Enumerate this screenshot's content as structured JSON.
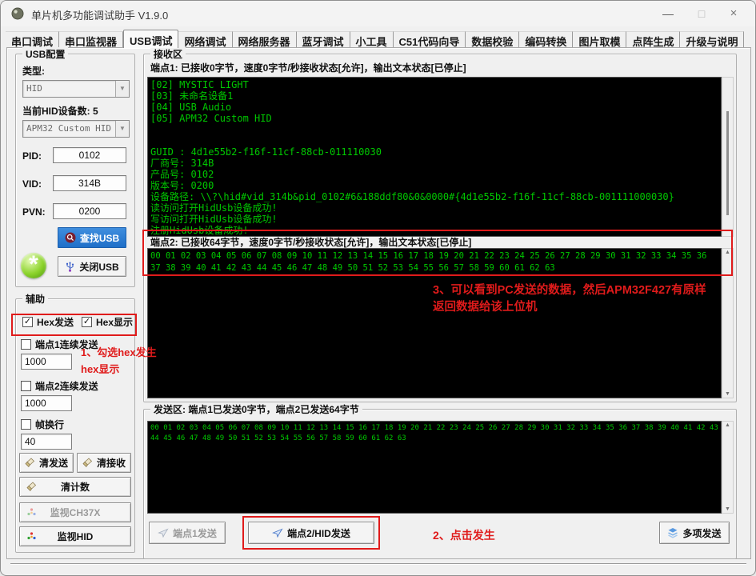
{
  "window": {
    "title": "单片机多功能调试助手 V1.9.0",
    "controls": {
      "minimize": "—",
      "maximize": "□",
      "close": "×"
    }
  },
  "tabs": {
    "active": "USB调试",
    "items": [
      "串口调试",
      "串口监视器",
      "USB调试",
      "网络调试",
      "网络服务器",
      "蓝牙调试",
      "小工具",
      "C51代码向导",
      "数据校验",
      "编码转换",
      "图片取模",
      "点阵生成",
      "升级与说明"
    ]
  },
  "usb_config": {
    "title": "USB配置",
    "type_label": "类型:",
    "type_value": "HID",
    "device_count_label": "当前HID设备数: 5",
    "device_value": "APM32 Custom HID",
    "pid_label": "PID:",
    "pid_value": "0102",
    "vid_label": "VID:",
    "vid_value": "314B",
    "pvn_label": "PVN:",
    "pvn_value": "0200",
    "find_usb_label": "查找USB",
    "close_usb_label": "关闭USB",
    "orb_glyph": "*"
  },
  "aux": {
    "title": "辅助",
    "hex_send_label": "Hex发送",
    "hex_display_label": "Hex显示",
    "hex_send_checked": "✓",
    "hex_display_checked": "✓",
    "ep1_cont_label": "端点1连续发送",
    "ep1_interval": "1000",
    "ep2_cont_label": "端点2连续发送",
    "ep2_interval": "1000",
    "frame_wrap_label": "帧换行",
    "frame_wrap_value": "40",
    "clear_send_label": "清发送",
    "clear_recv_label": "清接收",
    "clear_count_label": "清计数",
    "monitor_ch37x_label": "监视CH37X",
    "monitor_hid_label": "监视HID"
  },
  "receive": {
    "title": "接收区",
    "ep1_status": "端点1: 已接收0字节，速度0字节/秒接收状态[允许]，输出文本状态[已停止]",
    "terminal1_lines": [
      "[02] MYSTIC LIGHT",
      "[03] 未命名设备1",
      "[04] USB Audio",
      "[05] APM32 Custom HID",
      "",
      "",
      "GUID : 4d1e55b2-f16f-11cf-88cb-011110030",
      "厂商号: 314B",
      "产品号: 0102",
      "版本号: 0200",
      "设备路径: \\\\?\\hid#vid_314b&pid_0102#6&188ddf80&0&0000#{4d1e55b2-f16f-11cf-88cb-001111000030}",
      "读访问打开HidUsb设备成功!",
      "写访问打开HidUsb设备成功!",
      "注册HidUsb设备成功!"
    ],
    "ep2_status": "端点2: 已接收64字节，速度0字节/秒接收状态[允许]，输出文本状态[已停止]",
    "terminal2_lines": [
      "00 01 02 03 04 05 06 07 08 09 10 11 12 13 14 15 16 17 18 19 20 21 22 23 24 25 26 27 28 29 30 31 32 33 34 35 36",
      "37 38 39 40 41 42 43 44 45 46 47 48 49 50 51 52 53 54 55 56 57 58 59 60 61 62 63"
    ]
  },
  "send": {
    "title": "发送区: 端点1已发送0字节，端点2已发送64字节",
    "terminal_lines": [
      "00 01 02 03 04 05 06 07 08 09 10 11 12 13 14 15 16 17 18 19 20 21 22 23 24 25 26 27 28 29 30 31 32 33 34 35 36 37 38 39 40 41 42 43",
      "44 45 46 47 48 49 50 51 52 53 54 55 56 57 58 59 60 61 62 63"
    ],
    "ep1_send_label": "端点1发送",
    "ep2_send_label": "端点2/HID发送",
    "multi_send_label": "多项发送"
  },
  "annotations": {
    "note1_lines": [
      "1、勾选hex发生",
      "hex显示"
    ],
    "note2": "2、点击发生",
    "note3_lines": [
      "3、可以看到PC发送的数据，然后APM32F427有原样",
      "返回数据给该上位机"
    ]
  },
  "colors": {
    "terminal_bg": "#000000",
    "terminal_green": "#00c800",
    "annotation_red": "#e01b1b",
    "accent_blue": "#2478d2",
    "window_bg": "#f0f0f0"
  }
}
